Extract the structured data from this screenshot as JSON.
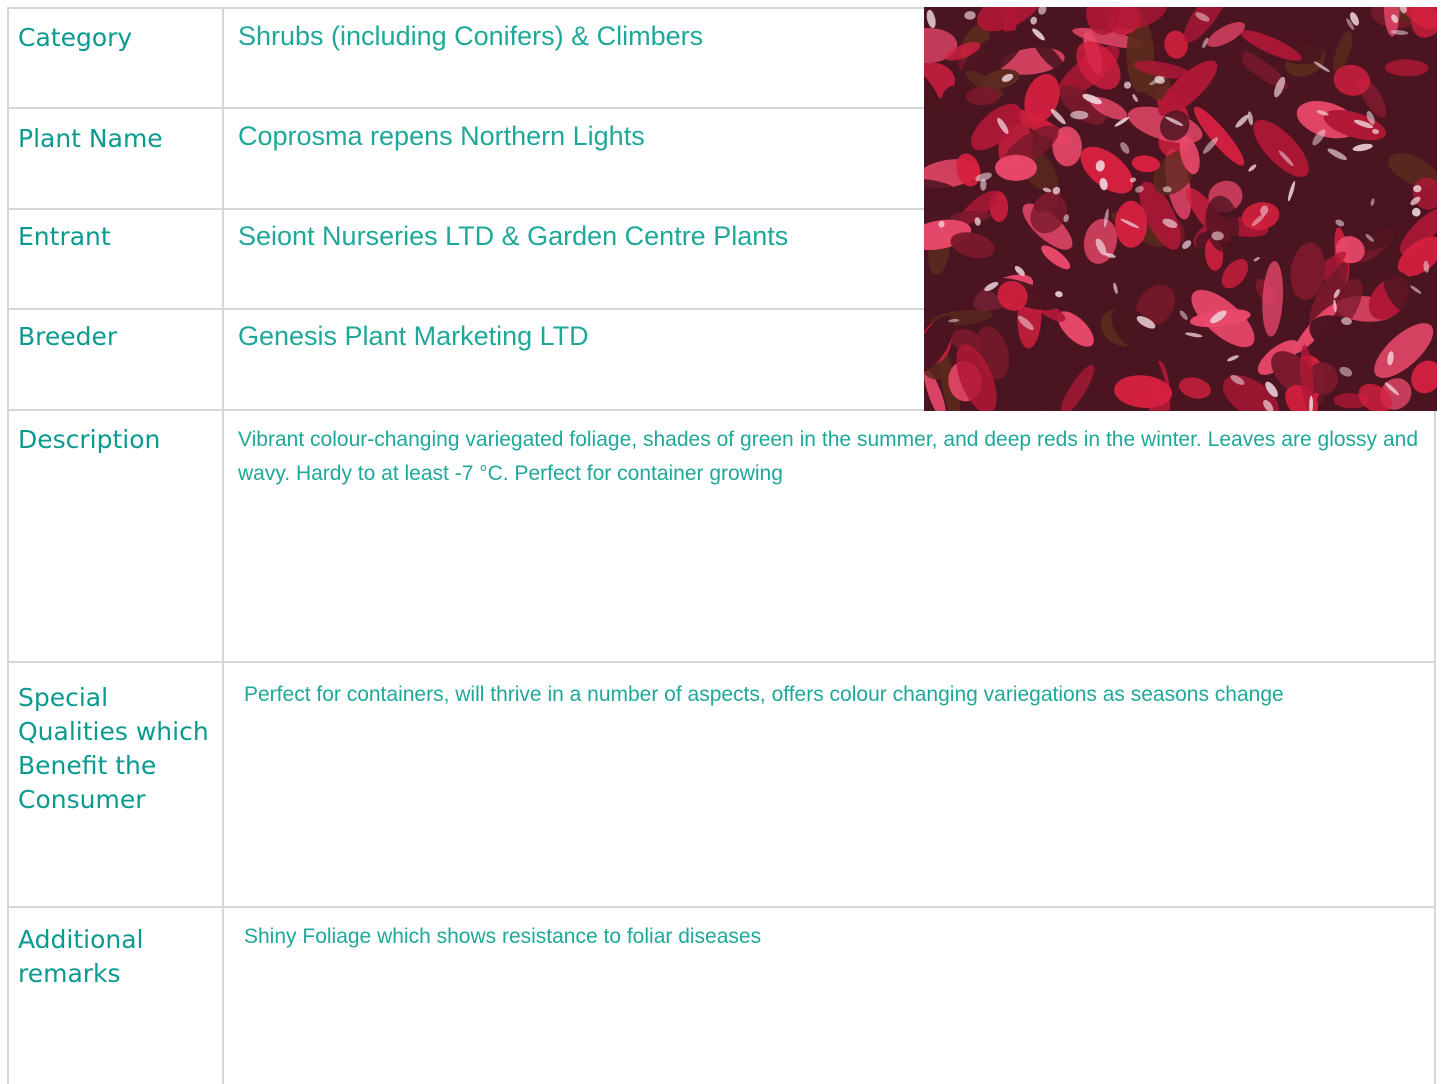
{
  "rows": {
    "category": {
      "label": "Category",
      "value": "Shrubs (including Conifers) & Climbers"
    },
    "plant_name": {
      "label": "Plant Name",
      "value": "Coprosma repens Northern Lights"
    },
    "entrant": {
      "label": "Entrant",
      "value": "Seiont Nurseries LTD & Garden Centre Plants"
    },
    "breeder": {
      "label": "Breeder",
      "value": "Genesis Plant Marketing LTD"
    },
    "description": {
      "label": "Description",
      "value": "Vibrant colour-changing variegated foliage, shades of green in the summer, and deep reds in the winter. Leaves are glossy and wavy. Hardy to at least -7 °C. Perfect for container growing"
    },
    "special_qualities": {
      "label_lines": [
        "Special",
        "Qualities which",
        "Benefit the",
        "Consumer"
      ],
      "value": "Perfect for containers, will thrive in a number of aspects, offers colour changing variegations as seasons change"
    },
    "additional_remarks": {
      "label_lines": [
        "Additional",
        "remarks"
      ],
      "value": "Shiny Foliage which shows resistance to foliar diseases"
    }
  },
  "colors": {
    "label_text": "#0a9a8f",
    "value_text": "#1fa899",
    "grid_line": "#d6d6d6",
    "foliage_dark": "#4a1420",
    "foliage_red": "#d4203f",
    "foliage_pink": "#e8486a",
    "foliage_highlight": "#f2d9e0"
  },
  "image": {
    "subject": "plant-photo"
  }
}
